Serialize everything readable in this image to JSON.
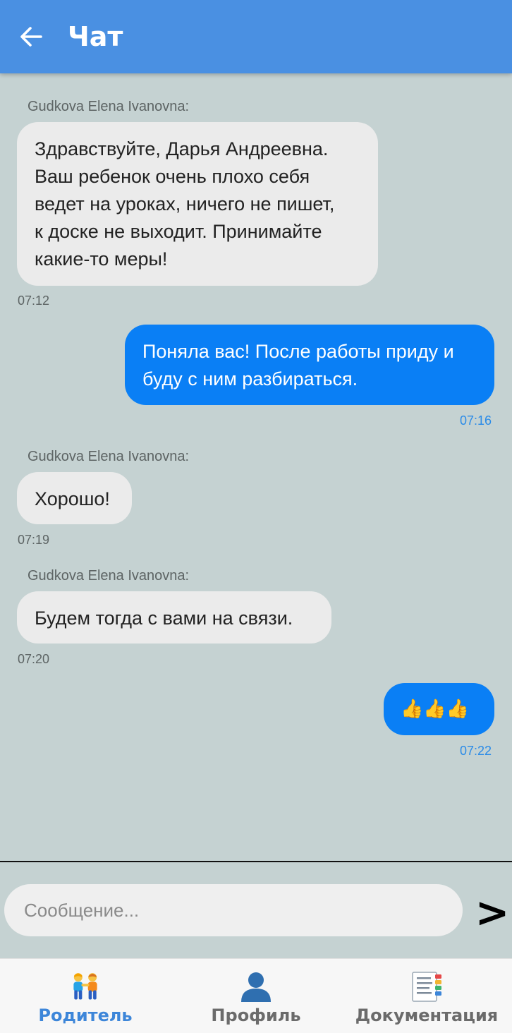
{
  "header": {
    "title": "Чат",
    "back_icon": "arrow-left-icon"
  },
  "colors": {
    "appbar": "#4a90e2",
    "chat_background": "#c5d2d2",
    "incoming_bubble": "#ebebeb",
    "outgoing_bubble": "#0a7ff5",
    "outgoing_time": "#2a8be8",
    "nav_active": "#3d86d9"
  },
  "messages": [
    {
      "direction": "incoming",
      "sender": "Gudkova Elena Ivanovna:",
      "lines": [
        "Здравствуйте, Дарья Андреевна.",
        "Ваш ребенок очень плохо себя",
        "ведет на уроках, ничего не пишет,",
        "к доске не выходит. Принимайте",
        "какие-то меры!"
      ],
      "time": "07:12"
    },
    {
      "direction": "outgoing",
      "lines": [
        "Поняла вас! После работы приду и",
        "буду с ним разбираться."
      ],
      "time": "07:16"
    },
    {
      "direction": "incoming",
      "sender": "Gudkova Elena Ivanovna:",
      "lines": [
        "Хорошо!"
      ],
      "time": "07:19"
    },
    {
      "direction": "incoming",
      "sender": "Gudkova Elena Ivanovna:",
      "lines": [
        "Будем тогда с вами на связи."
      ],
      "time": "07:20"
    },
    {
      "direction": "outgoing",
      "lines": [
        "👍👍👍"
      ],
      "time": "07:22"
    }
  ],
  "composer": {
    "placeholder": "Сообщение...",
    "value": "",
    "send_label": ">"
  },
  "nav": {
    "items": [
      {
        "label": "Родитель",
        "icon": "parents-icon",
        "active": true
      },
      {
        "label": "Профиль",
        "icon": "profile-icon",
        "active": false
      },
      {
        "label": "Документация",
        "icon": "documents-icon",
        "active": false
      }
    ]
  }
}
